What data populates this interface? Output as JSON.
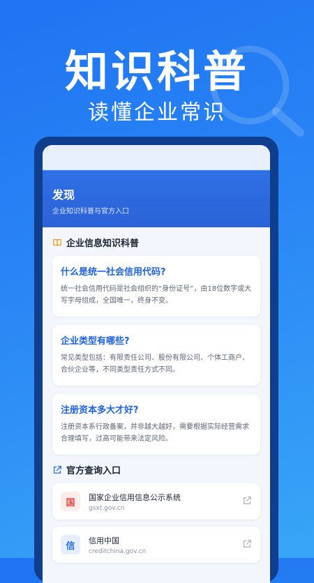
{
  "hero": {
    "title": "知识科普",
    "subtitle": "读懂企业常识"
  },
  "screen": {
    "header_title": "发现",
    "header_desc": "企业知识科普与官方入口"
  },
  "knowledge_section": {
    "title": "企业信息知识科普",
    "icon": "book-icon",
    "cards": [
      {
        "question": "什么是统一社会信用代码?",
        "answer": "统一社会信用代码是社会组织的“身份证号”，由18位数字或大写字母组成，全国唯一，终身不变。"
      },
      {
        "question": "企业类型有哪些?",
        "answer": "常见类型包括：有限责任公司、股份有限公司、个体工商户、合伙企业等，不同类型责任方式不同。"
      },
      {
        "question": "注册资本多大才好?",
        "answer": "注册资本系行政备案，并非越大越好，需要根据实际经营需求合理填写，过高可能带来法定风险。"
      }
    ]
  },
  "official_section": {
    "title": "官方查询入口",
    "icon": "external-link-icon",
    "entries": [
      {
        "badge": "国",
        "name": "国家企业信用信息公示系统",
        "url": "gsxt.gov.cn",
        "badge_color": "#e0483d",
        "badge_bg": "#fdecea"
      },
      {
        "badge": "信",
        "name": "信用中国",
        "url": "creditchina.gov.cn",
        "badge_color": "#2a6ee6",
        "badge_bg": "#e6efff"
      }
    ]
  },
  "colors": {
    "accent": "#1f62e0",
    "background_gradient_start": "#1f74f2",
    "background_gradient_end": "#38a6f7"
  }
}
